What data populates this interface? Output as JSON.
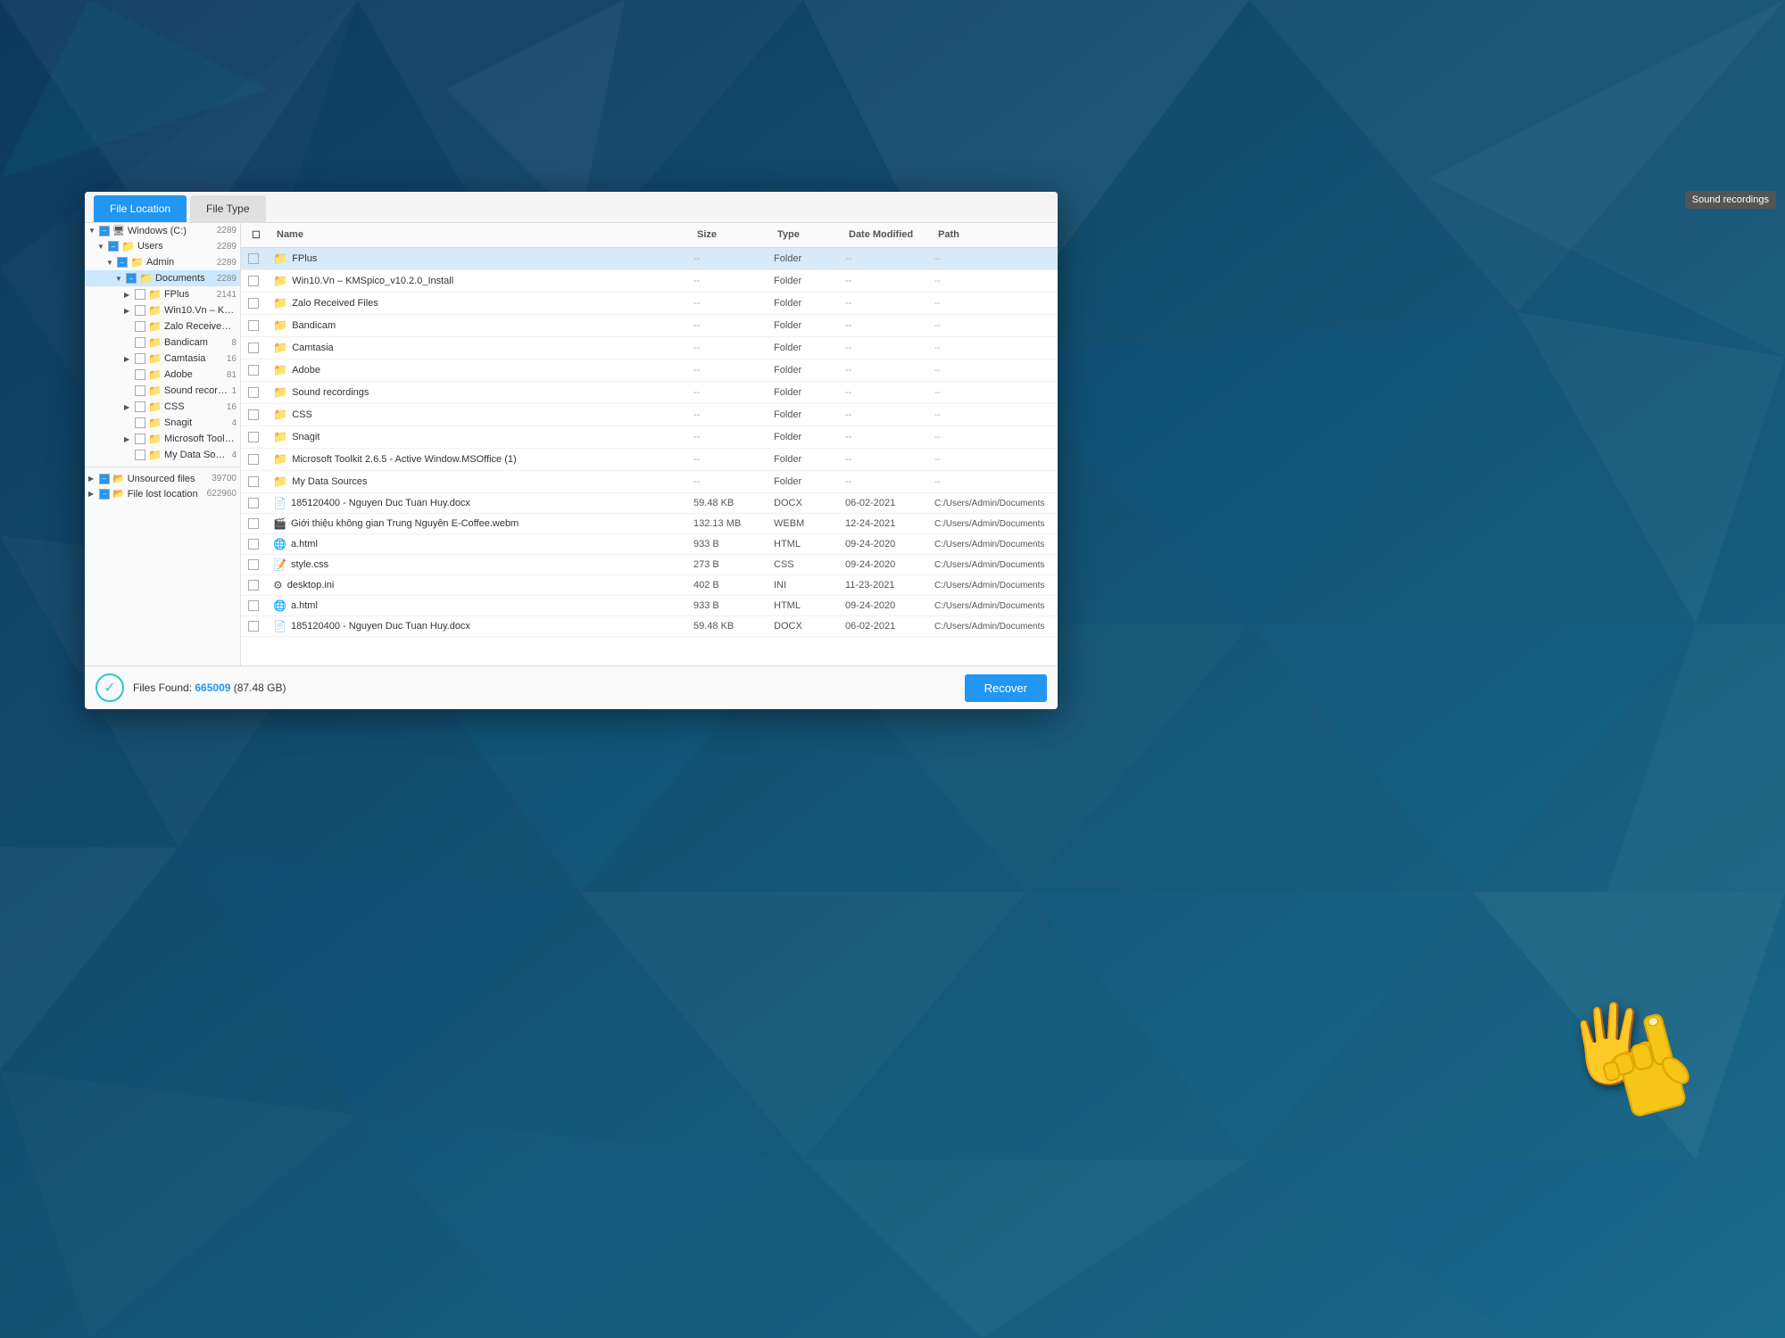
{
  "background": {
    "color": "#1a4a6e"
  },
  "tabs": {
    "file_location_label": "File Location",
    "file_type_label": "File Type"
  },
  "sidebar": {
    "windows_c": {
      "label": "Windows (C:)",
      "count": "2289"
    },
    "users": {
      "label": "Users",
      "count": "2289"
    },
    "admin": {
      "label": "Admin",
      "count": "2289"
    },
    "documents": {
      "label": "Documents",
      "count": "2289"
    },
    "fplus": {
      "label": "FPlus",
      "count": "2141"
    },
    "win10": {
      "label": "Win10.Vn – KMS…",
      "count": ""
    },
    "zalo": {
      "label": "Zalo Received Fil…",
      "count": ""
    },
    "bandicam": {
      "label": "Bandicam",
      "count": "8"
    },
    "camtasia": {
      "label": "Camtasia",
      "count": "16"
    },
    "adobe": {
      "label": "Adobe",
      "count": "81"
    },
    "sound_recordings": {
      "label": "Sound recordings",
      "count": "1"
    },
    "css": {
      "label": "CSS",
      "count": "16"
    },
    "snagit": {
      "label": "Snagit",
      "count": "4"
    },
    "ms_toolkit": {
      "label": "Microsoft Toolki…",
      "count": ""
    },
    "my_data_sources": {
      "label": "My Data Sources",
      "count": "4"
    },
    "unsourced": {
      "label": "Unsourced files",
      "count": "39700"
    },
    "file_lost": {
      "label": "File lost location",
      "count": "622960"
    }
  },
  "table": {
    "headers": {
      "name": "Name",
      "size": "Size",
      "type": "Type",
      "date_modified": "Date Modified",
      "path": "Path"
    },
    "rows": [
      {
        "name": "FPlus",
        "size": "--",
        "type": "Folder",
        "date": "--",
        "path": "--",
        "icon": "folder",
        "selected": true
      },
      {
        "name": "Win10.Vn – KMSpico_v10.2.0_Install",
        "size": "--",
        "type": "Folder",
        "date": "--",
        "path": "--",
        "icon": "folder",
        "selected": false
      },
      {
        "name": "Zalo Received Files",
        "size": "--",
        "type": "Folder",
        "date": "--",
        "path": "--",
        "icon": "folder",
        "selected": false
      },
      {
        "name": "Bandicam",
        "size": "--",
        "type": "Folder",
        "date": "--",
        "path": "--",
        "icon": "folder",
        "selected": false
      },
      {
        "name": "Camtasia",
        "size": "--",
        "type": "Folder",
        "date": "--",
        "path": "--",
        "icon": "folder",
        "selected": false
      },
      {
        "name": "Adobe",
        "size": "--",
        "type": "Folder",
        "date": "--",
        "path": "--",
        "icon": "folder",
        "selected": false
      },
      {
        "name": "Sound recordings",
        "size": "--",
        "type": "Folder",
        "date": "--",
        "path": "--",
        "icon": "folder",
        "selected": false
      },
      {
        "name": "CSS",
        "size": "--",
        "type": "Folder",
        "date": "--",
        "path": "--",
        "icon": "folder",
        "selected": false
      },
      {
        "name": "Snagit",
        "size": "--",
        "type": "Folder",
        "date": "--",
        "path": "--",
        "icon": "folder",
        "selected": false
      },
      {
        "name": "Microsoft Toolkit 2.6.5 - Active Window.MSOffice (1)",
        "size": "--",
        "type": "Folder",
        "date": "--",
        "path": "--",
        "icon": "folder",
        "selected": false
      },
      {
        "name": "My Data Sources",
        "size": "--",
        "type": "Folder",
        "date": "--",
        "path": "--",
        "icon": "folder",
        "selected": false
      },
      {
        "name": "185120400 - Nguyen Duc Tuan Huy.docx",
        "size": "59.48 KB",
        "type": "DOCX",
        "date": "06-02-2021",
        "path": "C:/Users/Admin/Documents",
        "icon": "docx",
        "selected": false
      },
      {
        "name": "Giới thiệu không gian Trung Nguyên E-Coffee.webm",
        "size": "132.13 MB",
        "type": "WEBM",
        "date": "12-24-2021",
        "path": "C:/Users/Admin/Documents",
        "icon": "video",
        "selected": false
      },
      {
        "name": "a.html",
        "size": "933 B",
        "type": "HTML",
        "date": "09-24-2020",
        "path": "C:/Users/Admin/Documents",
        "icon": "html",
        "selected": false
      },
      {
        "name": "style.css",
        "size": "273 B",
        "type": "CSS",
        "date": "09-24-2020",
        "path": "C:/Users/Admin/Documents",
        "icon": "css",
        "selected": false
      },
      {
        "name": "desktop.ini",
        "size": "402 B",
        "type": "INI",
        "date": "11-23-2021",
        "path": "C:/Users/Admin/Documents",
        "icon": "ini",
        "selected": false
      },
      {
        "name": "a.html",
        "size": "933 B",
        "type": "HTML",
        "date": "09-24-2020",
        "path": "C:/Users/Admin/Documents",
        "icon": "html",
        "selected": false
      },
      {
        "name": "185120400 - Nguyen Duc Tuan Huy.docx",
        "size": "59.48 KB",
        "type": "DOCX",
        "date": "06-02-2021",
        "path": "C:/Users/Admin/Documents",
        "icon": "docx",
        "selected": false
      }
    ]
  },
  "tooltip": {
    "text": "Sound recordings"
  },
  "footer": {
    "files_found_label": "Files Found:",
    "files_found_count": "665009",
    "files_found_size": "(87.48 GB)",
    "recover_label": "Recover"
  },
  "cursor": {
    "emoji": "👆"
  }
}
